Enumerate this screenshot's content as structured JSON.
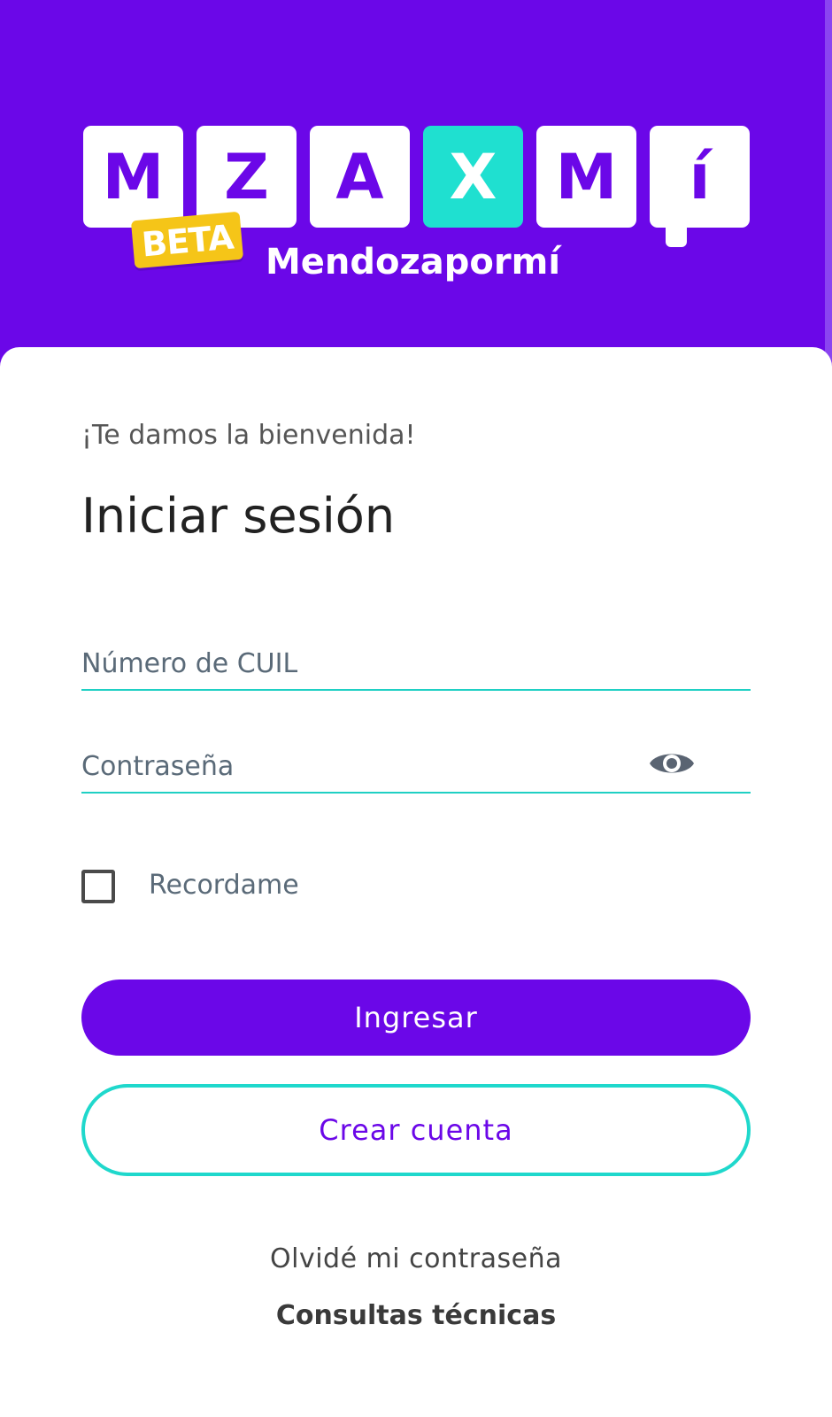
{
  "header": {
    "logo_tiles": [
      "M",
      "Z",
      "A",
      "X",
      "M",
      "í"
    ],
    "beta_badge": "BETA",
    "brand_name": "Mendozapormí"
  },
  "login": {
    "welcome": "¡Te damos la bienvenida!",
    "title": "Iniciar sesión",
    "cuil_placeholder": "Número de CUIL",
    "password_placeholder": "Contraseña",
    "remember_label": "Recordame",
    "remember_checked": false,
    "submit_label": "Ingresar",
    "create_account_label": "Crear cuenta",
    "forgot_password_label": "Olvidé mi contraseña",
    "support_label": "Consultas técnicas"
  },
  "icons": {
    "password_toggle": "eye-icon"
  },
  "colors": {
    "brand": "#6b07e8",
    "accent": "#1fe0d0",
    "beta": "#f5c518"
  }
}
